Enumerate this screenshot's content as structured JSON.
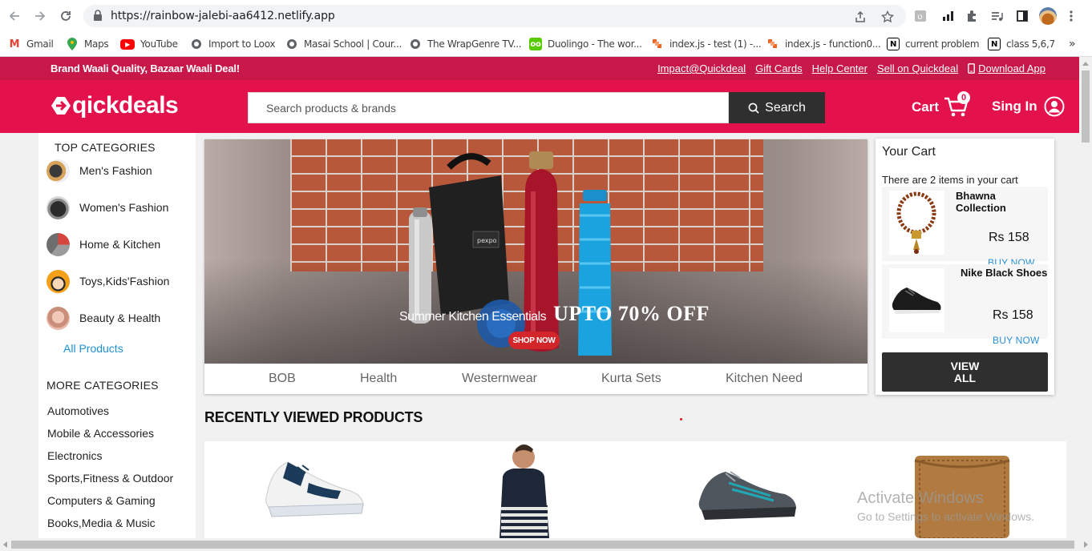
{
  "browser": {
    "url": "https://rainbow-jalebi-aa6412.netlify.app",
    "bookmarks": [
      {
        "label": "Gmail",
        "icon": "gmail-icon",
        "color": "#ea4335"
      },
      {
        "label": "Maps",
        "icon": "maps-icon",
        "color": "#34a853"
      },
      {
        "label": "YouTube",
        "icon": "youtube-icon",
        "color": "#ff0000"
      },
      {
        "label": "Import to Loox",
        "icon": "globe-icon",
        "color": "#5f6368"
      },
      {
        "label": "Masai School | Cour...",
        "icon": "globe-icon",
        "color": "#5f6368"
      },
      {
        "label": "The WrapGenre TV...",
        "icon": "globe-icon",
        "color": "#5f6368"
      },
      {
        "label": "Duolingo - The wor...",
        "icon": "duolingo-icon",
        "color": "#58cc02"
      },
      {
        "label": "index.js - test (1) -...",
        "icon": "codesandbox-icon",
        "color": "#f26522"
      },
      {
        "label": "index.js - function0...",
        "icon": "codesandbox-icon",
        "color": "#f26522"
      },
      {
        "label": "current problem",
        "icon": "notion-icon",
        "color": "#000000"
      },
      {
        "label": "class 5,6,7",
        "icon": "notion-icon",
        "color": "#000000"
      }
    ],
    "more_bookmarks": "»"
  },
  "site": {
    "brand_color": "#e3114c",
    "strip_color": "#c8184a",
    "tagline": "Brand Waali Quality, Bazaar Waali Deal!",
    "top_links": [
      "Impact@Quickdeal",
      "Gift Cards",
      "Help Center",
      "Sell on Quickdeal",
      "Download App"
    ],
    "logo_text": "qickdeals",
    "search": {
      "placeholder": "Search products & brands",
      "button": "Search"
    },
    "cart_label": "Cart",
    "cart_count": "0",
    "signin_label": "Sing In"
  },
  "sidebar": {
    "top_heading": "TOP CATEGORIES",
    "top_categories": [
      "Men's Fashion",
      "Women's Fashion",
      "Home & Kitchen",
      "Toys,Kids'Fashion",
      "Beauty & Health"
    ],
    "all_products": "All Products",
    "more_heading": "MORE CATEGORIES",
    "more_categories": [
      "Automotives",
      "Mobile & Accessories",
      "Electronics",
      "Sports,Fitness & Outdoor",
      "Computers & Gaming",
      "Books,Media & Music"
    ]
  },
  "banner": {
    "small_text": "Summer Kitchen Essentials",
    "big_text": "UPTO 70% OFF",
    "shop_now": "SHOP NOW",
    "tabs": [
      "BOB",
      "Health",
      "Westernwear",
      "Kurta Sets",
      "Kitchen Need"
    ]
  },
  "cart": {
    "title": "Your Cart",
    "subtitle": "There are 2 items in your cart",
    "items": [
      {
        "name": "Bhawna Collection",
        "price": "Rs 158",
        "action": "BUY NOW"
      },
      {
        "name": "Nike Black Shoes",
        "price": "Rs 158",
        "action": "BUY NOW"
      }
    ],
    "view_all": "VIEW ALL"
  },
  "recently_viewed": {
    "title": "RECENTLY VIEWED PRODUCTS",
    "items": [
      "sneaker-white-navy",
      "striped-tshirt",
      "sports-shoe-grey",
      "leather-wallet"
    ]
  },
  "watermark": {
    "line1": "Activate Windows",
    "line2": "Go to Settings to activate Windows."
  }
}
